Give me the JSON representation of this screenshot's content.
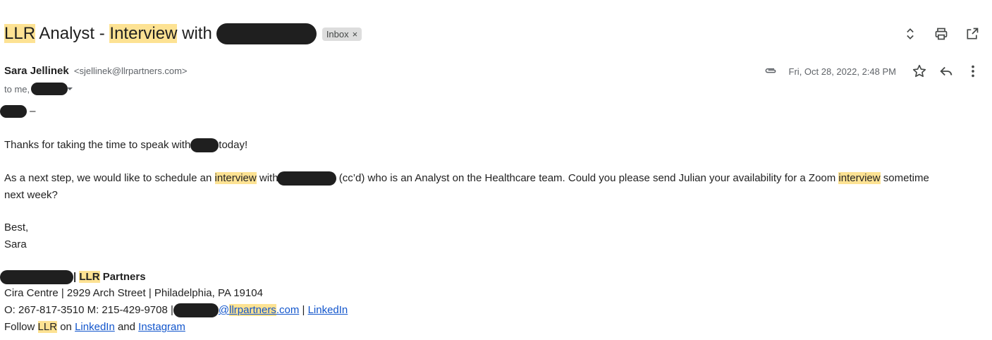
{
  "subject": {
    "part1": "LLR",
    "part2": " Analyst - ",
    "part3": "Interview",
    "part4": " with",
    "label_chip": "Inbox",
    "chip_close": "×"
  },
  "sender": {
    "name": "Sara Jellinek",
    "email": "<sjellinek@llrpartners.com>",
    "to_prefix": "to me,",
    "date": "Fri, Oct 28, 2022, 2:48 PM"
  },
  "body": {
    "greeting_suffix": " –",
    "line1_a": "Thanks for taking the time to speak with",
    "line1_b": "today!",
    "line2_a": "As a next step, we would like to schedule an ",
    "line2_hl1": "interview",
    "line2_b": " with",
    "line2_c": " (cc’d) who is an Analyst on the Healthcare team. Could you please send Julian your availability for a Zoom ",
    "line2_hl2": "interview",
    "line2_d": " sometime",
    "line2_e": "next week?",
    "closing1": "Best,",
    "closing2": "Sara"
  },
  "signature": {
    "company_sep": "| ",
    "company_hl": "LLR",
    "company_rest": " Partners",
    "address": "Cira Centre | 2929 Arch Street | Philadelphia, PA 19104",
    "phones": "O: 267-817-3510 M: 215-429-9708 |",
    "email_at": "@",
    "email_domain_hl": "llrpartners",
    "email_tld": ".com",
    "pipe": " | ",
    "linkedin1": "LinkedIn",
    "follow_a": "Follow ",
    "follow_hl": "LLR",
    "follow_b": " on ",
    "linkedin2": "LinkedIn",
    "follow_and": " and ",
    "instagram": "Instagram"
  },
  "icons": {
    "expand": "unfold-icon",
    "print": "print-icon",
    "popout": "open-in-new-icon",
    "attachment": "paperclip-icon",
    "star": "star-icon",
    "reply": "reply-icon",
    "more": "more-vert-icon"
  }
}
